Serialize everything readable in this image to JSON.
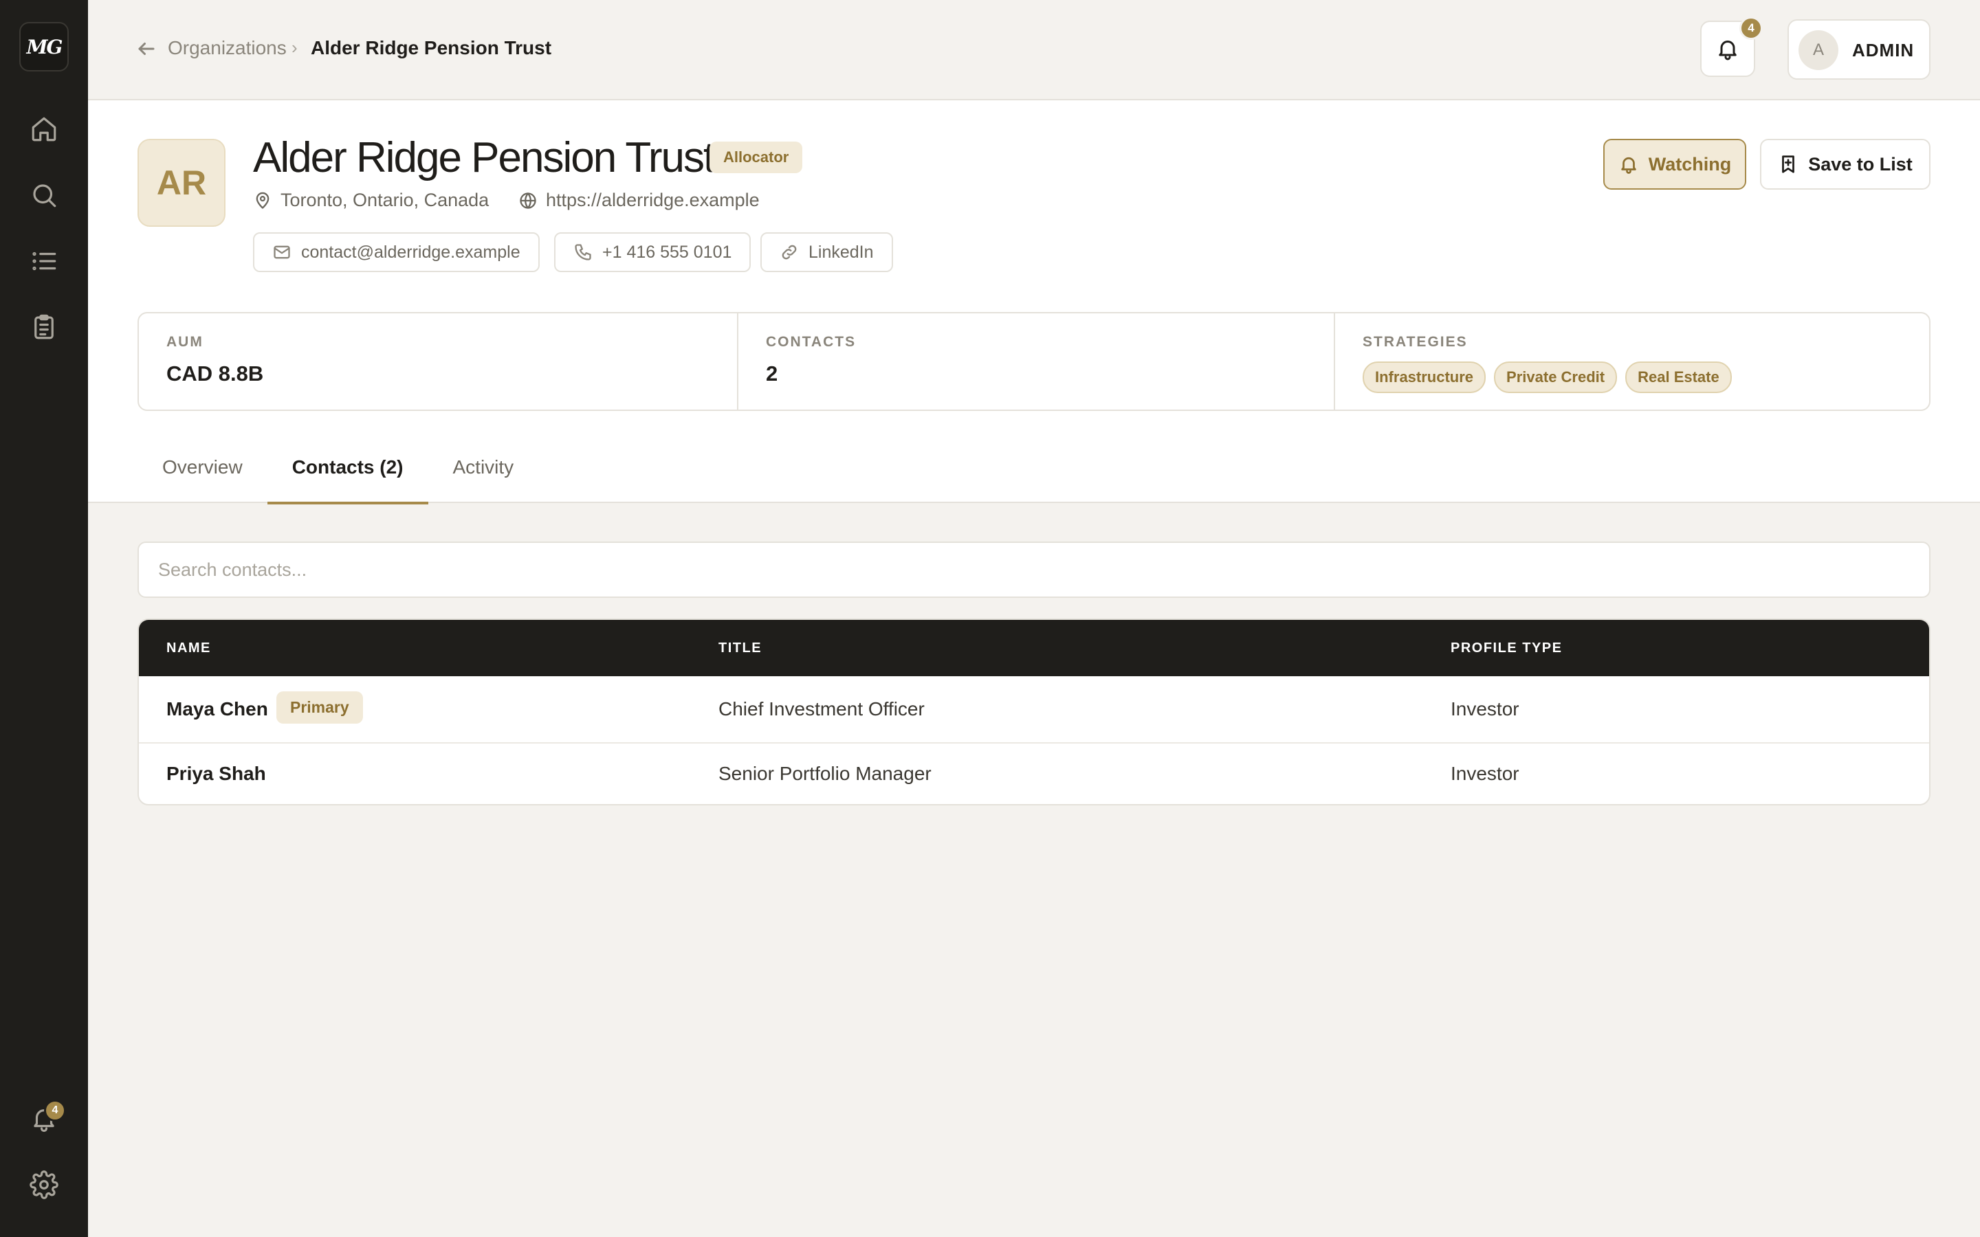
{
  "sidebar": {
    "logo": "MG",
    "notification_count": "4"
  },
  "topbar": {
    "breadcrumb_parent": "Organizations",
    "breadcrumb_separator": "›",
    "breadcrumb_current": "Alder Ridge Pension Trust",
    "notification_count": "4",
    "user_initial": "A",
    "user_label": "ADMIN"
  },
  "org": {
    "initials": "AR",
    "name": "Alder Ridge Pension Trust",
    "type_badge": "Allocator",
    "location": "Toronto, Ontario, Canada",
    "website": "https://alderridge.example",
    "email": "contact@alderridge.example",
    "phone": "+1 416 555 0101",
    "linkedin": "LinkedIn",
    "watch_label": "Watching",
    "save_label": "Save to List"
  },
  "stats": {
    "aum_label": "AUM",
    "aum_value": "CAD 8.8B",
    "contacts_label": "CONTACTS",
    "contacts_value": "2",
    "strategies_label": "STRATEGIES",
    "strategies": [
      "Infrastructure",
      "Private Credit",
      "Real Estate"
    ]
  },
  "tabs": [
    {
      "label": "Overview",
      "active": false
    },
    {
      "label": "Contacts (2)",
      "active": true
    },
    {
      "label": "Activity",
      "active": false
    }
  ],
  "contacts": {
    "search_placeholder": "Search contacts...",
    "columns": [
      "NAME",
      "TITLE",
      "PROFILE TYPE"
    ],
    "rows": [
      {
        "name": "Maya Chen",
        "badge": "Primary",
        "title": "Chief Investment Officer",
        "profile_type": "Investor"
      },
      {
        "name": "Priya Shah",
        "badge": "",
        "title": "Senior Portfolio Manager",
        "profile_type": "Investor"
      }
    ]
  },
  "colors": {
    "accent": "#a68a4a",
    "accent_bg": "#f2ead8",
    "sidebar_bg": "#1f1e1b",
    "page_bg": "#f4f2ee"
  }
}
